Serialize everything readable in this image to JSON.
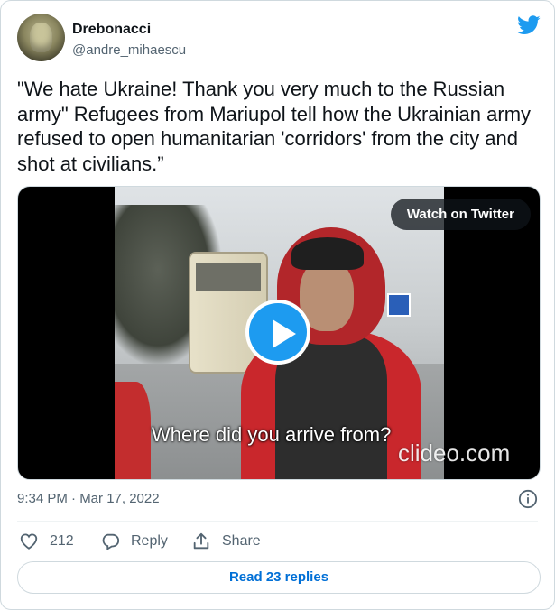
{
  "author": {
    "name": "Drebonacci",
    "handle": "@andre_mihaescu"
  },
  "tweet": {
    "text": "\"We hate Ukraine! Thank you very much to the Russian army\" Refugees from Mariupol tell how the Ukrainian army refused to open humanitarian 'corridors' from the city and shot at civilians.”"
  },
  "media": {
    "watch_label": "Watch on Twitter",
    "caption": "Where did you arrive from?",
    "watermark": "clideo.com"
  },
  "meta": {
    "timestamp": "9:34 PM · Mar 17, 2022"
  },
  "actions": {
    "like_count": "212",
    "reply_label": "Reply",
    "share_label": "Share"
  },
  "read_replies_label": "Read 23 replies",
  "icons": {
    "brand": "twitter-bird-icon",
    "play": "play-icon",
    "info": "info-icon",
    "like": "heart-icon",
    "reply": "reply-bubble-icon",
    "share": "share-icon"
  },
  "colors": {
    "accent": "#1d9bf0",
    "link": "#006fd6",
    "secondary_text": "#536471"
  }
}
